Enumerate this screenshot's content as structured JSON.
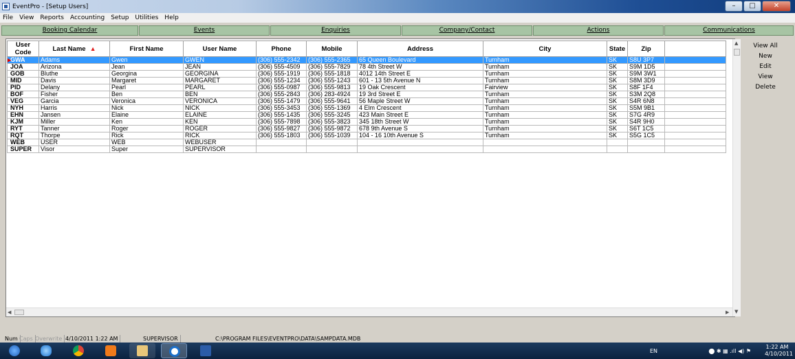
{
  "window": {
    "title": "EventPro - [Setup Users]",
    "minimize": "–",
    "maximize": "□",
    "close": "✕"
  },
  "menu": [
    "File",
    "View",
    "Reports",
    "Accounting",
    "Setup",
    "Utilities",
    "Help"
  ],
  "nav": [
    "Booking Calendar",
    "Events",
    "Enquiries",
    "Company/Contact",
    "Actions",
    "Communications"
  ],
  "columns": [
    "User Code",
    "Last Name",
    "First Name",
    "User Name",
    "Phone",
    "Mobile",
    "Address",
    "City",
    "State",
    "Zip"
  ],
  "sort_indicator": "▲",
  "rows": [
    [
      "GWA",
      "Adams",
      "Gwen",
      "GWEN",
      "(306) 555-2342",
      "(306) 555-2365",
      "65 Queen Boulevard",
      "Turnham",
      "SK",
      "S8U 3P7"
    ],
    [
      "JOA",
      "Arizona",
      "Jean",
      "JEAN",
      "(306) 555-4509",
      "(306) 555-7829",
      "78 4th Street W",
      "Turnham",
      "SK",
      "S9M 1D5"
    ],
    [
      "GOB",
      "Bluthe",
      "Georgina",
      "GEORGINA",
      "(306) 555-1919",
      "(306) 555-1818",
      "4012 14th Street E",
      "Turnham",
      "SK",
      "S9M 3W1"
    ],
    [
      "MID",
      "Davis",
      "Margaret",
      "MARGARET",
      "(306) 555-1234",
      "(306) 555-1243",
      "601 - 13 5th Avenue N",
      "Turnham",
      "SK",
      "S8M 3D9"
    ],
    [
      "PID",
      "Delany",
      "Pearl",
      "PEARL",
      "(306) 555-0987",
      "(306) 555-9813",
      "19 Oak Crescent",
      "Fairview",
      "SK",
      "S8F 1F4"
    ],
    [
      "BOF",
      "Fisher",
      "Ben",
      "BEN",
      "(306) 555-2843",
      "(306) 283-4924",
      "19 3rd Street E",
      "Turnham",
      "SK",
      "S3M 2Q8"
    ],
    [
      "VEG",
      "Garcia",
      "Veronica",
      "VERONICA",
      "(306) 555-1479",
      "(306) 555-9641",
      "56 Maple Street W",
      "Turnham",
      "SK",
      "S4R 6N8"
    ],
    [
      "NYH",
      "Harris",
      "Nick",
      "NICK",
      "(306) 555-3453",
      "(306) 555-1369",
      "4 Elm Crescent",
      "Turnham",
      "SK",
      "S5M 9B1"
    ],
    [
      "EHN",
      "Jansen",
      "Elaine",
      "ELAINE",
      "(306) 555-1435",
      "(306) 555-3245",
      "423 Main Street E",
      "Turnham",
      "SK",
      "S7G 4R9"
    ],
    [
      "KJM",
      "Miller",
      "Ken",
      "KEN",
      "(306) 555-7898",
      "(306) 555-3823",
      "345 18th Street W",
      "Turnham",
      "SK",
      "S4R 9H0"
    ],
    [
      "RYT",
      "Tanner",
      "Roger",
      "ROGER",
      "(306) 555-9827",
      "(306) 555-9872",
      "678 9th Avenue S",
      "Turnham",
      "SK",
      "S6T 1C5"
    ],
    [
      "RQT",
      "Thorpe",
      "Rick",
      "RICK",
      "(306) 555-1803",
      "(306) 555-1039",
      "104 - 16 10th Avenue S",
      "Turnham",
      "SK",
      "S5G 1C5"
    ],
    [
      "WEB",
      "USER",
      "WEB",
      "WEBUSER",
      "",
      "",
      "",
      "",
      "",
      ""
    ],
    [
      "SUPER",
      "Visor",
      "Super",
      "SUPERVISOR",
      "",
      "",
      "",
      "",
      "",
      ""
    ]
  ],
  "selected_row_index": 0,
  "actions": [
    "View All",
    "New",
    "Edit",
    "View",
    "Delete"
  ],
  "status": {
    "num": "Num",
    "caps": "Caps",
    "overwrite": "Overwrite",
    "datetime": "4/10/2011 1:22 AM",
    "user": "SUPERVISOR",
    "path": "C:\\PROGRAM FILES\\EVENTPRO\\DATA\\SAMPDATA.MDB"
  },
  "taskbar": {
    "icons": [
      "start-orb",
      "internet-explorer",
      "chrome",
      "media-player",
      "file-explorer",
      "teamviewer",
      "word"
    ],
    "lang": "EN",
    "tray_glyphs": "⬤ ✱ ▦ .ıll ◀) ⚑",
    "time": "1:22 AM",
    "date": "4/10/2011"
  },
  "colors": {
    "selection": "#3399ff",
    "nav_button": "#a7c4a4",
    "sort_arrow": "#e02020"
  }
}
